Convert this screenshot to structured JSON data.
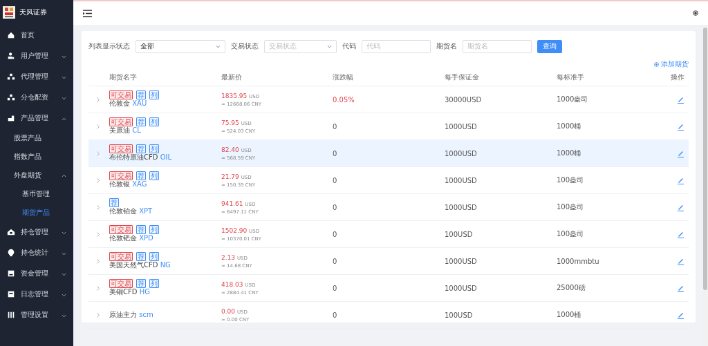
{
  "sidebar": {
    "brand": "天风证券",
    "items": [
      {
        "label": "首页"
      },
      {
        "label": "用户管理",
        "expanded": false
      },
      {
        "label": "代理管理",
        "expanded": false
      },
      {
        "label": "分仓配资",
        "expanded": false
      },
      {
        "label": "产品管理",
        "expanded": true,
        "children": [
          {
            "label": "股票产品",
            "selected": false
          },
          {
            "label": "指数产品",
            "selected": false
          },
          {
            "label": "外盘期货",
            "expanded": true,
            "children": [
              {
                "label": "基币管理",
                "selected": false
              },
              {
                "label": "期货产品",
                "selected": true
              }
            ]
          }
        ]
      },
      {
        "label": "持仓管理",
        "expanded": false
      },
      {
        "label": "持仓统计",
        "expanded": false
      },
      {
        "label": "资金管理",
        "expanded": false
      },
      {
        "label": "日志管理",
        "expanded": false
      },
      {
        "label": "管理设置",
        "expanded": false
      }
    ]
  },
  "filters": [
    {
      "kind": "select",
      "label": "列表显示状态",
      "value": "全部"
    },
    {
      "kind": "select",
      "label": "交易状态",
      "placeholder": "交易状态"
    },
    {
      "kind": "input",
      "label": "代码",
      "placeholder": "代码"
    },
    {
      "kind": "input",
      "label": "期货名",
      "placeholder": "期货名"
    }
  ],
  "query_button": "查询",
  "add_link": "添加期货",
  "table": {
    "columns": [
      "期货名字",
      "最新价",
      "涨跌幅",
      "每手保证金",
      "每标准手",
      "操作"
    ],
    "rows": [
      {
        "selected": false,
        "tags": [
          {
            "kind": "status",
            "text": "可交易"
          },
          {
            "kind": "flag",
            "text": "荐"
          },
          {
            "kind": "flag",
            "text": "列"
          }
        ],
        "name": "伦敦金",
        "code": "XAU",
        "price": "1835.95",
        "price_unit": "USD",
        "converted": "≈ 12668.06 CNY",
        "change": "0.05%",
        "color": "#e0454d",
        "margin": "30000USD",
        "lot": "1000盎司"
      },
      {
        "selected": false,
        "tags": [
          {
            "kind": "status",
            "text": "可交易"
          },
          {
            "kind": "flag",
            "text": "荐"
          },
          {
            "kind": "flag",
            "text": "列"
          }
        ],
        "name": "美原油",
        "code": "CL",
        "price": "75.95",
        "price_unit": "USD",
        "converted": "≈ 524.03 CNY",
        "change": "0",
        "margin": "1000USD",
        "lot": "1000桶"
      },
      {
        "selected": true,
        "tags": [
          {
            "kind": "status",
            "text": "可交易"
          },
          {
            "kind": "flag",
            "text": "荐"
          },
          {
            "kind": "flag",
            "text": "列"
          }
        ],
        "name": "布伦特原油CFD",
        "code": "OIL",
        "price": "82.40",
        "price_unit": "USD",
        "converted": "≈ 568.59 CNY",
        "change": "0",
        "margin": "1000USD",
        "lot": "1000桶"
      },
      {
        "selected": false,
        "tags": [
          {
            "kind": "status",
            "text": "可交易"
          },
          {
            "kind": "flag",
            "text": "荐"
          },
          {
            "kind": "flag",
            "text": "列"
          }
        ],
        "name": "伦敦银",
        "code": "XAG",
        "price": "21.79",
        "price_unit": "USD",
        "converted": "≈ 150.35 CNY",
        "change": "0",
        "margin": "1000USD",
        "lot": "100盎司"
      },
      {
        "selected": false,
        "tags": [
          {
            "kind": "flag",
            "text": "荐"
          }
        ],
        "name": "伦敦铂金",
        "code": "XPT",
        "price": "941.61",
        "price_unit": "USD",
        "converted": "≈ 6497.11 CNY",
        "change": "0",
        "margin": "1000USD",
        "lot": "100盎司"
      },
      {
        "selected": false,
        "tags": [
          {
            "kind": "status",
            "text": "可交易"
          },
          {
            "kind": "flag",
            "text": "荐"
          },
          {
            "kind": "flag",
            "text": "列"
          }
        ],
        "name": "伦敦钯金",
        "code": "XPD",
        "price": "1502.90",
        "price_unit": "USD",
        "converted": "≈ 10370.01 CNY",
        "change": "0",
        "margin": "100USD",
        "lot": "100盎司"
      },
      {
        "selected": false,
        "tags": [
          {
            "kind": "status",
            "text": "可交易"
          },
          {
            "kind": "flag",
            "text": "荐"
          },
          {
            "kind": "flag",
            "text": "列"
          }
        ],
        "name": "美国天然气CFD",
        "code": "NG",
        "price": "2.13",
        "price_unit": "USD",
        "converted": "≈ 14.68 CNY",
        "change": "0",
        "margin": "1000USD",
        "lot": "1000mmbtu"
      },
      {
        "selected": false,
        "tags": [
          {
            "kind": "status",
            "text": "可交易"
          },
          {
            "kind": "flag",
            "text": "荐"
          },
          {
            "kind": "flag",
            "text": "列"
          }
        ],
        "name": "美铜CFD",
        "code": "HG",
        "price": "418.03",
        "price_unit": "USD",
        "converted": "≈ 2884.41 CNY",
        "change": "0",
        "margin": "1000USD",
        "lot": "25000磅"
      },
      {
        "selected": false,
        "tags": [],
        "name": "原油主力",
        "code": "scm",
        "price": "0.00",
        "price_unit": "USD",
        "converted": "≈ 0.00 CNY",
        "change": "0",
        "margin": "100USD",
        "lot": "1000桶"
      }
    ]
  }
}
